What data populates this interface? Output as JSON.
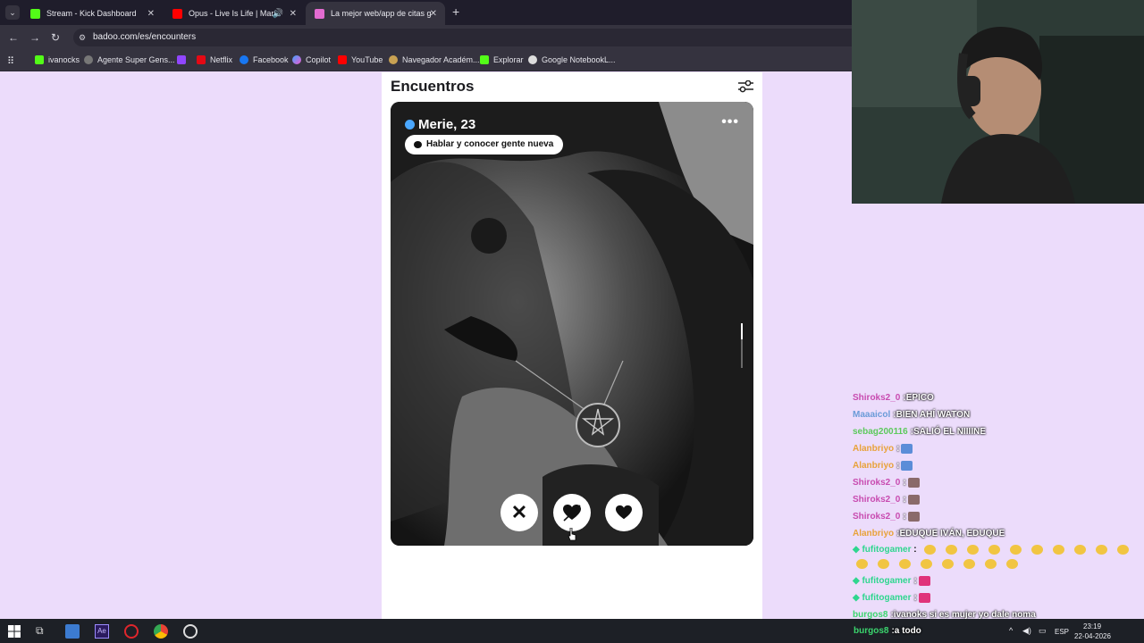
{
  "browser": {
    "tabs": [
      {
        "title": "Stream - Kick Dashboard",
        "active": false
      },
      {
        "title": "Opus - Live Is Life | Marado",
        "active": false
      },
      {
        "title": "La mejor web/app de citas gra",
        "active": true
      }
    ],
    "url": "badoo.com/es/encounters",
    "bookmarks": [
      "ivanocks",
      "Agente Super Gens...",
      "Netflix",
      "Facebook",
      "Copilot",
      "YouTube",
      "Navegador Académ...",
      "Explorar",
      "Google NotebookL..."
    ]
  },
  "badoo": {
    "title": "Encuentros",
    "profile_name": "Merie, 23",
    "chip_text": "Hablar y conocer gente nueva"
  },
  "chat": [
    {
      "user": "Shiroks2_0",
      "color": "#c84bb0",
      "text": "EPICO"
    },
    {
      "user": "Maaaicol",
      "color": "#6a9bd8",
      "text": "BIEN AHÍ WATON"
    },
    {
      "user": "sebag200116",
      "color": "#5cc95c",
      "text": "SALIÓ EL NIIIINE"
    },
    {
      "user": "Alanbriyo",
      "color": "#e8a23a",
      "text": ""
    },
    {
      "user": "Alanbriyo",
      "color": "#e8a23a",
      "text": ""
    },
    {
      "user": "Shiroks2_0",
      "color": "#c84bb0",
      "text": ""
    },
    {
      "user": "Shiroks2_0",
      "color": "#c84bb0",
      "text": ""
    },
    {
      "user": "Shiroks2_0",
      "color": "#c84bb0",
      "text": ""
    },
    {
      "user": "Alanbriyo",
      "color": "#e8a23a",
      "text": "EDUQUE IVÁN, EDUQUE"
    },
    {
      "user": "fufitogamer",
      "color": "#2fd68f",
      "text": ""
    },
    {
      "user": "fufitogamer",
      "color": "#2fd68f",
      "text": ""
    },
    {
      "user": "fufitogamer",
      "color": "#2fd68f",
      "text": ""
    },
    {
      "user": "burgos8",
      "color": "#3bd66e",
      "text": "ivanoks si es mujer yo dale noma"
    },
    {
      "user": "burgos8",
      "color": "#3bd66e",
      "text": "a todo"
    }
  ],
  "taskbar": {
    "lang": "ESP",
    "time": "23:19",
    "date": "22-04-2026"
  }
}
